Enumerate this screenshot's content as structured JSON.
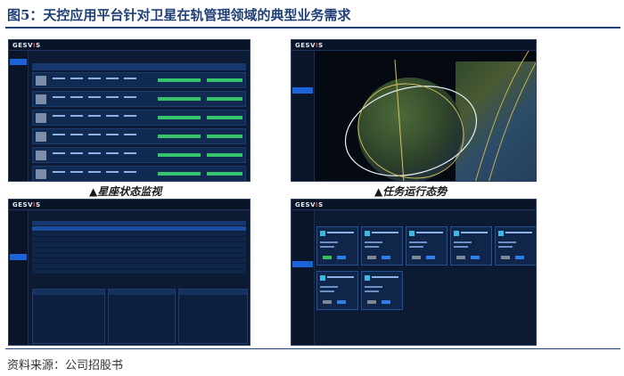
{
  "figure": {
    "title": "图5：天控应用平台针对卫星在轨管理领域的典型业务需求",
    "source": "资料来源：公司招股书"
  },
  "captions": {
    "panel1": "▲星座状态监视",
    "panel2": "▲任务运行态势"
  },
  "app": {
    "logo_text": "GESVIS",
    "logo_highlight": "I"
  },
  "colors": {
    "title": "#1f3f77",
    "screen_bg": "#0c1a33",
    "accent": "#1b63d6",
    "status_green": "#35c46a"
  }
}
